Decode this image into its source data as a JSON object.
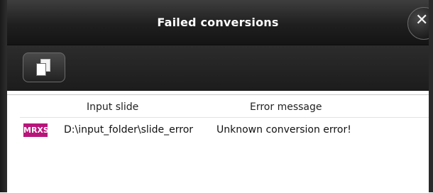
{
  "dialog": {
    "title": "Failed conversions",
    "close_glyph": "✕",
    "close_icon": "close-icon"
  },
  "toolbar": {
    "copy_icon": "copy-icon"
  },
  "table": {
    "columns": [
      "Input slide",
      "Error message"
    ],
    "rows": [
      {
        "format_badge": "MRXS",
        "input_slide": "D:\\input_folder\\slide_error",
        "error_message": "Unknown conversion error!"
      }
    ]
  },
  "colors": {
    "badge_bg": "#b8157a",
    "titlebar_bg": "#1f1f1f"
  }
}
